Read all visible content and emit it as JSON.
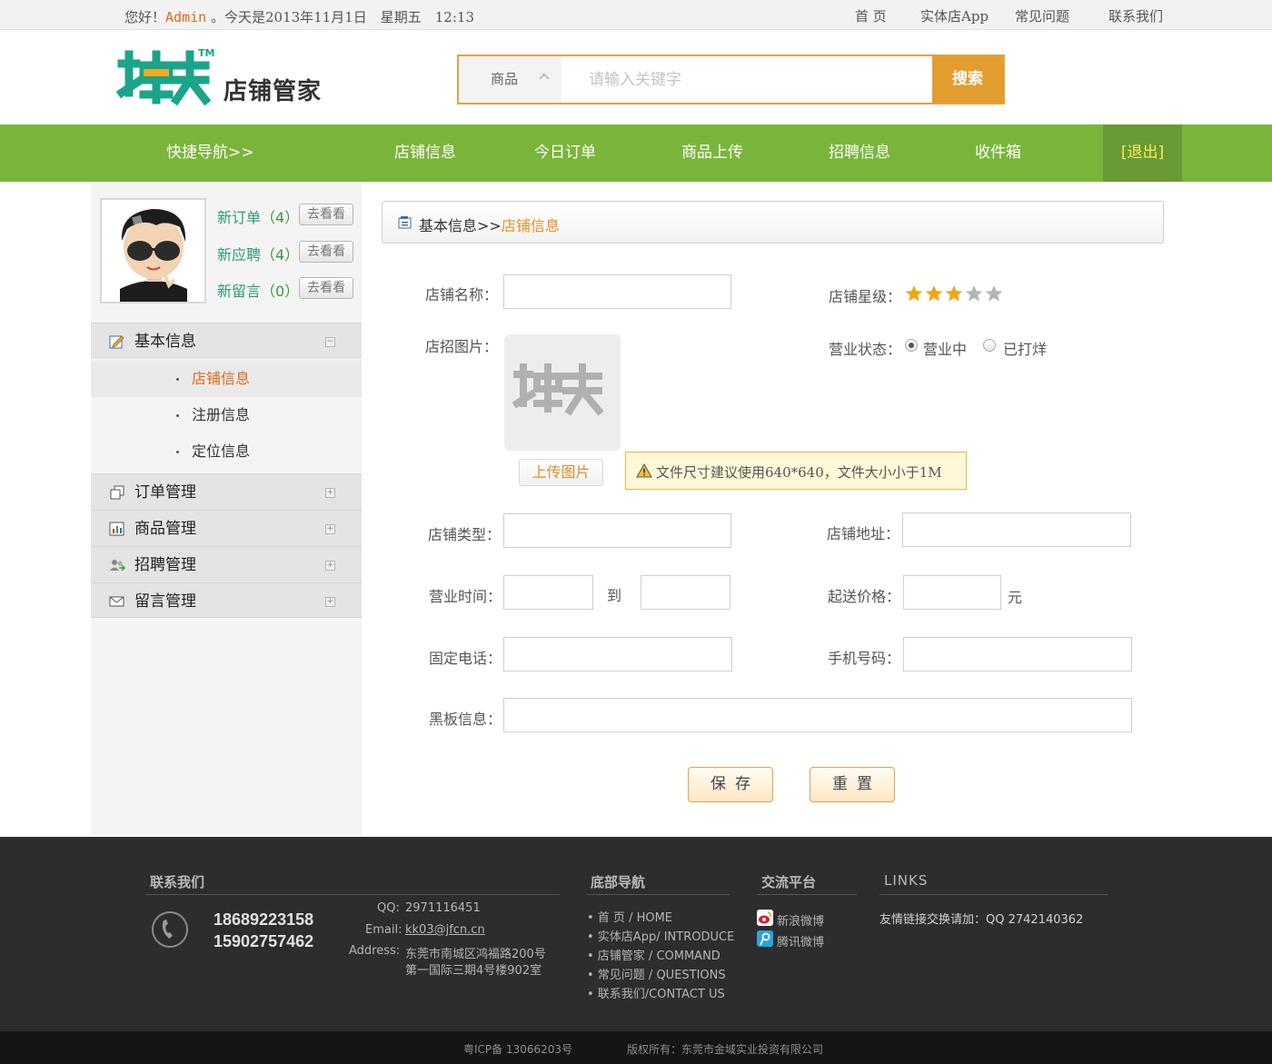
{
  "topbar": {
    "greeting_prefix": "您好！",
    "username": "Admin",
    "greeting_suffix": "。今天是2013年11月1日　星期五　12:13",
    "links": [
      "首 页",
      "实体店App",
      "常见问题",
      "联系我们"
    ]
  },
  "header": {
    "logo_mark": "快快",
    "logo_tm": "TM",
    "logo_text": "店铺管家",
    "search_category": "商品",
    "search_placeholder": "请输入关键字",
    "search_button": "搜索"
  },
  "nav": {
    "quick": "快捷导航>>",
    "items": [
      "店铺信息",
      "今日订单",
      "商品上传",
      "招聘信息",
      "收件箱"
    ],
    "logout": "[退出]"
  },
  "sidebar": {
    "notifications": [
      {
        "label": "新订单",
        "count": "（4）",
        "button": "去看看"
      },
      {
        "label": "新应聘",
        "count": "（4）",
        "button": "去看看"
      },
      {
        "label": "新留言",
        "count": "（0）",
        "button": "去看看"
      }
    ],
    "sections": {
      "basic": "基本信息",
      "orders": "订单管理",
      "products": "商品管理",
      "recruit": "招聘管理",
      "messages": "留言管理"
    },
    "subitems": [
      "店铺信息",
      "注册信息",
      "定位信息"
    ]
  },
  "breadcrumb": {
    "root": "基本信息>>",
    "current": "店铺信息"
  },
  "form": {
    "shop_name": "店铺名称：",
    "shop_rating": "店铺星级：",
    "rating_value": 3,
    "rating_max": 5,
    "sign_image": "店招图片：",
    "upload_button": "上传图片",
    "upload_tip": "文件尺寸建议使用640*640，文件大小小于1M",
    "business_status": "营业状态：",
    "status_open": "营业中",
    "status_closed": "已打烊",
    "shop_type": "店铺类型：",
    "shop_address": "店铺地址：",
    "business_hours": "营业时间：",
    "to": "到",
    "min_price": "起送价格：",
    "yuan": "元",
    "landline": "固定电话：",
    "mobile": "手机号码：",
    "blackboard": "黑板信息：",
    "save": "保存",
    "reset": "重置"
  },
  "footer": {
    "contact_title": "联系我们",
    "phone1": "18689223158",
    "phone2": "15902757462",
    "qq_label": "QQ:",
    "qq_value": "2971116451",
    "email_label": "Email:",
    "email_value": "kk03@jfcn.cn",
    "address_label": "Address:",
    "address_line1": "东莞市南城区鸿福路200号",
    "address_line2": "第一国际三期4号楼902室",
    "nav_title": "底部导航",
    "nav_links": [
      "• 首 页 / HOME",
      "• 实体店App/ INTRODUCE",
      "• 店铺管家 / COMMAND",
      "• 常见问题 / QUESTIONS",
      "• 联系我们/CONTACT US"
    ],
    "social_title": "交流平台",
    "social": [
      "新浪微博",
      "腾讯微博"
    ],
    "links_title": "LINKS",
    "links_text": "友情链接交换请加：QQ 2742140362",
    "icp": "粤ICP备 13066203号",
    "copyright": "版权所有：东莞市金域实业投资有限公司"
  },
  "colors": {
    "accent_green": "#79b53a",
    "accent_orange": "#e49d2f",
    "logo_green": "#1aa58a"
  }
}
